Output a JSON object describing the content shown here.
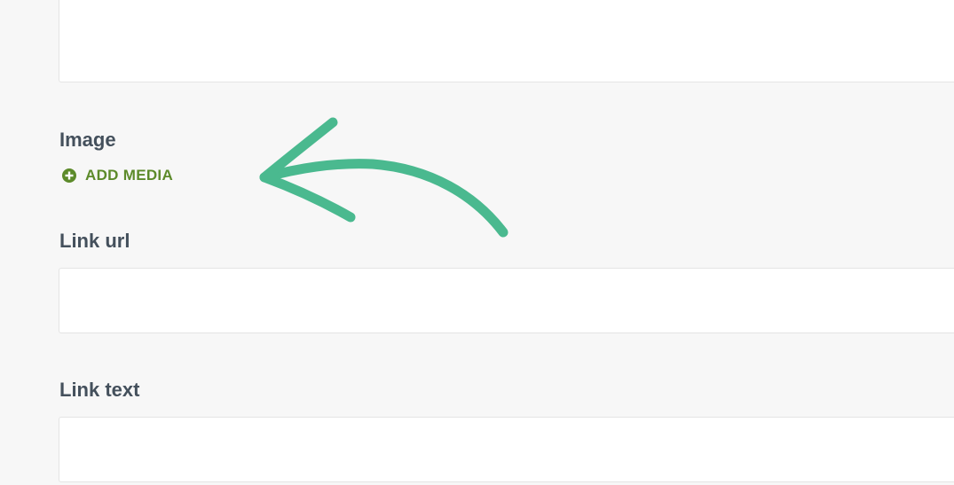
{
  "fields": {
    "image": {
      "label": "Image"
    },
    "add_media": {
      "label": "ADD MEDIA",
      "icon": "plus-circle-icon"
    },
    "link_url": {
      "label": "Link url",
      "value": "",
      "placeholder": ""
    },
    "link_text": {
      "label": "Link text",
      "value": "",
      "placeholder": ""
    }
  },
  "colors": {
    "label": "#44505c",
    "add_media": "#5c8a2a",
    "annotation_arrow": "#4ab98f",
    "background": "#f7f7f7"
  }
}
